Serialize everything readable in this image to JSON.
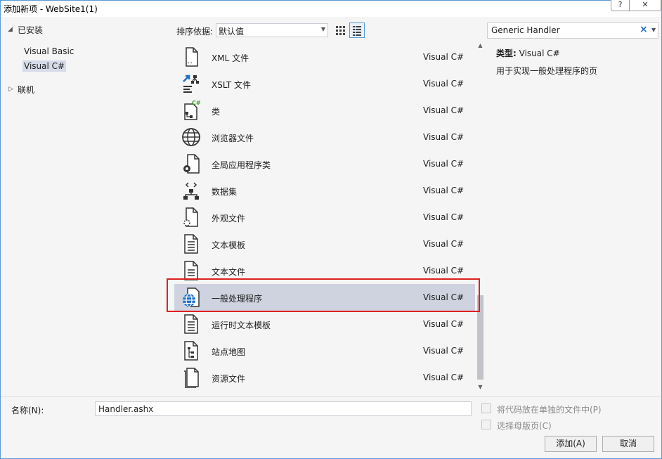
{
  "window": {
    "title": "添加新项 - WebSite1(1)",
    "help_label": "?",
    "close_label": "✕"
  },
  "tree": {
    "installed": "已安装",
    "languages": [
      "Visual Basic",
      "Visual C#"
    ],
    "selected_language": "Visual C#",
    "online": "联机"
  },
  "toolbar": {
    "sort_label": "排序依据:",
    "sort_value": "默认值"
  },
  "templates": [
    {
      "name": "XML 文件",
      "lang": "Visual C#",
      "icon": "xml-file-icon"
    },
    {
      "name": "XSLT 文件",
      "lang": "Visual C#",
      "icon": "xslt-file-icon"
    },
    {
      "name": "类",
      "lang": "Visual C#",
      "icon": "class-file-icon"
    },
    {
      "name": "浏览器文件",
      "lang": "Visual C#",
      "icon": "browser-file-icon"
    },
    {
      "name": "全局应用程序类",
      "lang": "Visual C#",
      "icon": "global-app-class-icon"
    },
    {
      "name": "数据集",
      "lang": "Visual C#",
      "icon": "dataset-icon"
    },
    {
      "name": "外观文件",
      "lang": "Visual C#",
      "icon": "skin-file-icon"
    },
    {
      "name": "文本模板",
      "lang": "Visual C#",
      "icon": "text-template-icon"
    },
    {
      "name": "文本文件",
      "lang": "Visual C#",
      "icon": "text-file-icon"
    },
    {
      "name": "一般处理程序",
      "lang": "Visual C#",
      "icon": "generic-handler-icon"
    },
    {
      "name": "运行时文本模板",
      "lang": "Visual C#",
      "icon": "runtime-text-template-icon"
    },
    {
      "name": "站点地图",
      "lang": "Visual C#",
      "icon": "sitemap-icon"
    },
    {
      "name": "资源文件",
      "lang": "Visual C#",
      "icon": "resource-file-icon"
    }
  ],
  "search": {
    "value": "Generic Handler"
  },
  "details": {
    "type_label": "类型:",
    "type_value": "Visual C#",
    "description": "用于实现一般处理程序的页"
  },
  "footer": {
    "name_label": "名称(N):",
    "name_value": "Handler.ashx",
    "place_code_label": "将代码放在单独的文件中(P)",
    "master_page_label": "选择母版页(C)",
    "add_label": "添加(A)",
    "cancel_label": "取消"
  },
  "colors": {
    "accent": "#5a9ad5",
    "selection": "#cfd3df",
    "highlight_border": "#e02020"
  }
}
